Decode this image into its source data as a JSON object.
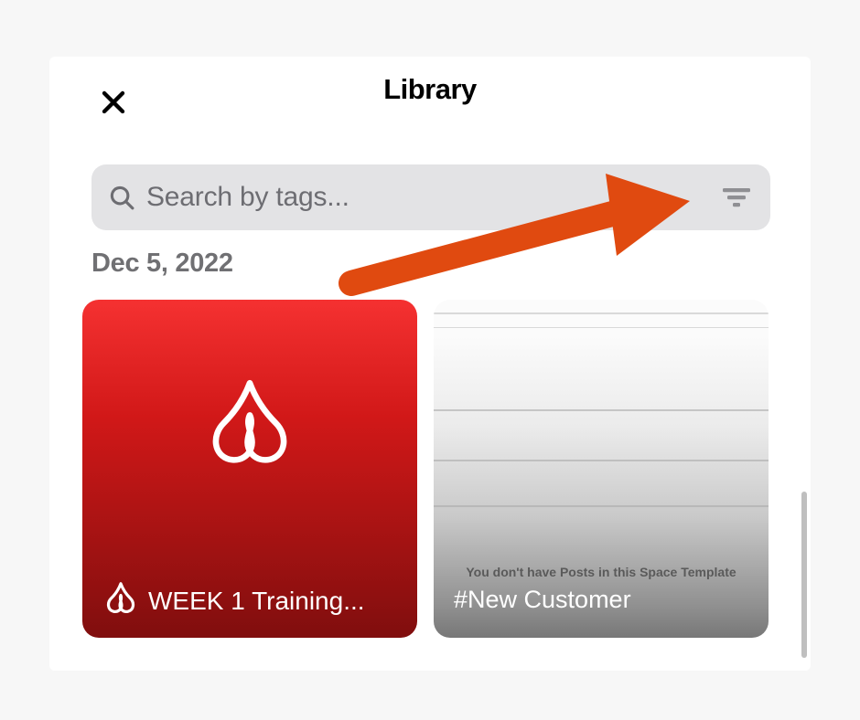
{
  "header": {
    "title": "Library"
  },
  "search": {
    "placeholder": "Search by tags..."
  },
  "date_group": "Dec 5, 2022",
  "cards": [
    {
      "type": "pdf",
      "title": "WEEK 1 Training..."
    },
    {
      "type": "empty_template",
      "empty_text": "You don't have Posts in this Space Template",
      "title": "#New Customer"
    }
  ],
  "annotation": {
    "arrow_color": "#e04a10"
  }
}
